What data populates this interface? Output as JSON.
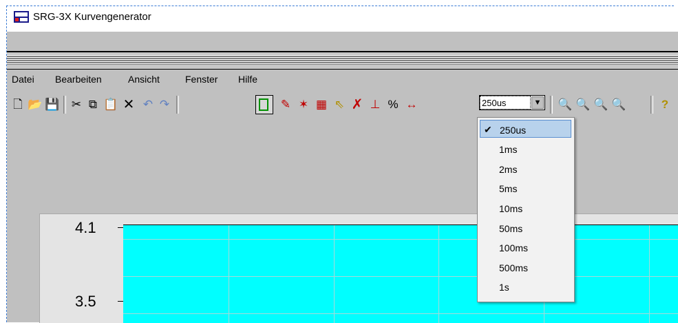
{
  "window": {
    "title": "SRG-3X Kurvengenerator"
  },
  "menu": {
    "items": [
      "Datei",
      "Bearbeiten",
      "Ansicht",
      "Fenster",
      "Hilfe"
    ]
  },
  "toolbar": {
    "icons": [
      "new-icon",
      "open-icon",
      "save-icon",
      "cut-icon",
      "copy-icon",
      "paste-icon",
      "delete-icon",
      "undo-icon",
      "redo-icon",
      "select-icon",
      "pencil-icon",
      "marker-icon",
      "grid-icon",
      "pointer-icon",
      "remove-icon",
      "anchor-icon",
      "link-icon",
      "width-icon",
      "zoom-in-icon",
      "zoom-out-icon",
      "zoom-fit-icon",
      "zoom-all-icon",
      "help-icon"
    ],
    "timebase": {
      "value": "250us"
    }
  },
  "dropdown": {
    "selected": "250us",
    "options": [
      "250us",
      "1ms",
      "2ms",
      "5ms",
      "10ms",
      "50ms",
      "100ms",
      "500ms",
      "1s"
    ]
  },
  "chart": {
    "y_tick_labels": [
      "4.1",
      "3.5"
    ],
    "background": "#00ffff"
  }
}
